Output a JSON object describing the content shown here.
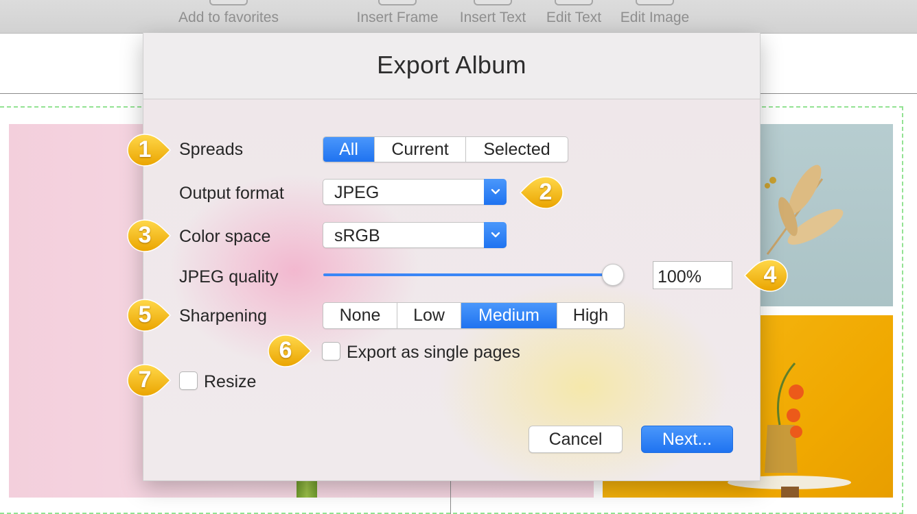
{
  "toolbar": {
    "items": [
      {
        "label": "Add to favorites"
      },
      {
        "label": "Insert Frame"
      },
      {
        "label": "Insert Text"
      },
      {
        "label": "Edit Text"
      },
      {
        "label": "Edit Image"
      }
    ]
  },
  "dialog": {
    "title": "Export Album",
    "spreads": {
      "label": "Spreads",
      "options": [
        "All",
        "Current",
        "Selected"
      ],
      "selected": "All"
    },
    "output_format": {
      "label": "Output format",
      "value": "JPEG"
    },
    "color_space": {
      "label": "Color space",
      "value": "sRGB"
    },
    "jpeg_quality": {
      "label": "JPEG quality",
      "value": "100%",
      "level": 1.0
    },
    "sharpening": {
      "label": "Sharpening",
      "options": [
        "None",
        "Low",
        "Medium",
        "High"
      ],
      "selected": "Medium"
    },
    "export_single_pages": {
      "label": "Export as single pages",
      "checked": false
    },
    "resize": {
      "label": "Resize",
      "checked": false
    },
    "cancel_label": "Cancel",
    "next_label": "Next..."
  },
  "callouts": [
    "1",
    "2",
    "3",
    "4",
    "5",
    "6",
    "7"
  ],
  "colors": {
    "accent": "#2a7cf5",
    "callout": "#f5b800",
    "guide": "#92e292"
  }
}
